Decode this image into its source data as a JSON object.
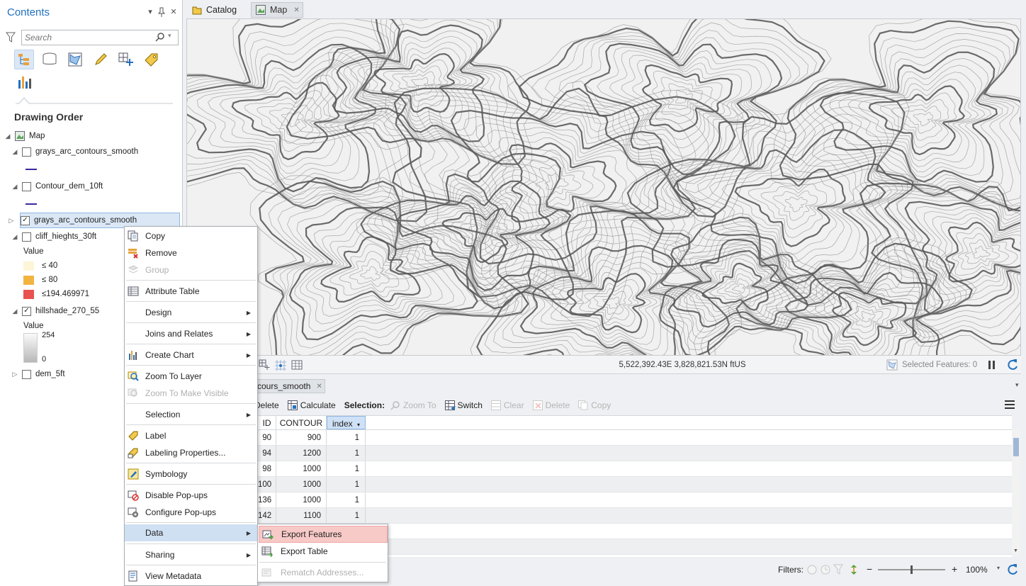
{
  "contents": {
    "title": "Contents",
    "search_placeholder": "Search",
    "section_heading": "Drawing Order",
    "map_label": "Map",
    "layers": [
      {
        "name": "grays_arc_contours_smooth",
        "checked": false
      },
      {
        "name": "Contour_dem_10ft",
        "checked": false
      },
      {
        "name": "grays_arc_contours_smooth",
        "checked": true,
        "selected": true
      },
      {
        "name": "cliff_hieghts_30ft",
        "checked": false
      },
      {
        "name": "hillshade_270_55",
        "checked": true
      },
      {
        "name": "dem_5ft",
        "checked": false
      }
    ],
    "cliff_legend": {
      "value_label": "Value",
      "classes": [
        {
          "label": "≤ 40",
          "color": "#fdf5d8"
        },
        {
          "label": "≤ 80",
          "color": "#f2b441"
        },
        {
          "label": "≤194.469971",
          "color": "#e8514f"
        }
      ]
    },
    "hillshade_legend": {
      "value_label": "Value",
      "max": "254",
      "min": "0"
    }
  },
  "tabs": {
    "catalog": "Catalog",
    "map": "Map"
  },
  "map_status": {
    "coordinates": "5,522,392.43E 3,828,821.53N ftUS",
    "selected_features": "Selected Features: 0"
  },
  "table": {
    "tab_label": "cours_smooth",
    "toolbar": {
      "delete": "Delete",
      "calculate": "Calculate",
      "selection_label": "Selection:",
      "zoom_to": "Zoom To",
      "switch": "Switch",
      "clear": "Clear",
      "delete_sel": "Delete",
      "copy": "Copy"
    },
    "columns": [
      "ID",
      "CONTOUR",
      "index"
    ],
    "rows": [
      [
        "90",
        "900",
        "1"
      ],
      [
        "94",
        "1200",
        "1"
      ],
      [
        "98",
        "1000",
        "1"
      ],
      [
        "100",
        "1000",
        "1"
      ],
      [
        "136",
        "1000",
        "1"
      ],
      [
        "142",
        "1100",
        "1"
      ]
    ],
    "status": {
      "filters_label": "Filters:",
      "zoom": "100%"
    }
  },
  "context_menu": {
    "items": [
      {
        "label": "Copy",
        "icon": "copy-icon"
      },
      {
        "label": "Remove",
        "icon": "remove-icon"
      },
      {
        "label": "Group",
        "icon": "group-icon",
        "disabled": true
      },
      {
        "label": "Attribute Table",
        "icon": "table-icon"
      },
      {
        "label": "Design",
        "icon": "",
        "submenu": true
      },
      {
        "label": "Joins and Relates",
        "icon": "",
        "submenu": true
      },
      {
        "label": "Create Chart",
        "icon": "chart-icon",
        "submenu": true
      },
      {
        "label": "Zoom To Layer",
        "icon": "zoom-layer-icon"
      },
      {
        "label": "Zoom To Make Visible",
        "icon": "zoom-visible-icon",
        "disabled": true
      },
      {
        "label": "Selection",
        "icon": "",
        "submenu": true
      },
      {
        "label": "Label",
        "icon": "label-icon"
      },
      {
        "label": "Labeling Properties...",
        "icon": "labeling-properties-icon"
      },
      {
        "label": "Symbology",
        "icon": "symbology-icon"
      },
      {
        "label": "Disable Pop-ups",
        "icon": "disable-popups-icon"
      },
      {
        "label": "Configure Pop-ups",
        "icon": "configure-popups-icon"
      },
      {
        "label": "Data",
        "icon": "",
        "submenu": true,
        "highlighted": true
      },
      {
        "label": "Sharing",
        "icon": "",
        "submenu": true
      },
      {
        "label": "View Metadata",
        "icon": "metadata-icon"
      }
    ]
  },
  "data_submenu": {
    "items": [
      {
        "label": "Export Features",
        "icon": "export-features-icon",
        "highlighted": true
      },
      {
        "label": "Export Table",
        "icon": "export-table-icon"
      },
      {
        "label": "Rematch Addresses...",
        "icon": "rematch-icon",
        "disabled": true
      }
    ]
  }
}
